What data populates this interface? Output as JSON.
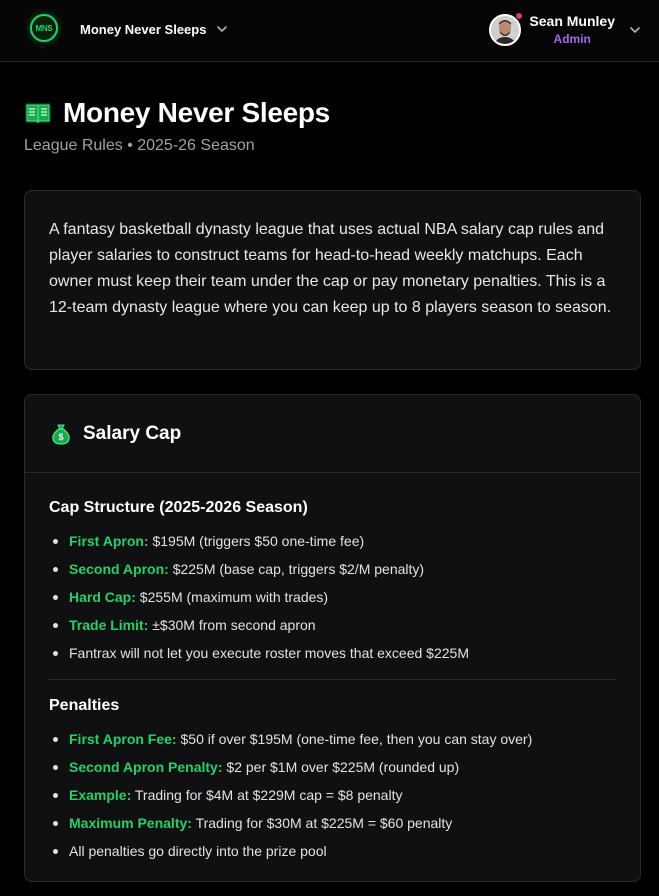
{
  "header": {
    "logo_text": "MNS",
    "league_name": "Money Never Sleeps",
    "user": {
      "name": "Sean Munley",
      "role": "Admin"
    }
  },
  "page": {
    "title": "Money Never Sleeps",
    "subtitle": "League Rules • 2025-26 Season"
  },
  "intro": {
    "text": "A fantasy basketball dynasty league that uses actual NBA salary cap rules and player salaries to construct teams for head-to-head weekly matchups. Each owner must keep their team under the cap or pay monetary penalties. This is a 12-team dynasty league where you can keep up to 8 players season to season."
  },
  "salary_cap": {
    "title": "Salary Cap",
    "cap_structure": {
      "heading": "Cap Structure (2025-2026 Season)",
      "items": [
        {
          "label": "First Apron:",
          "text": " $195M (triggers $50 one-time fee)"
        },
        {
          "label": "Second Apron:",
          "text": " $225M (base cap, triggers $2/M penalty)"
        },
        {
          "label": "Hard Cap:",
          "text": " $255M (maximum with trades)"
        },
        {
          "label": "Trade Limit:",
          "text": " ±$30M from second apron"
        },
        {
          "label": "",
          "text": "Fantrax will not let you execute roster moves that exceed $225M"
        }
      ]
    },
    "penalties": {
      "heading": "Penalties",
      "items": [
        {
          "label": "First Apron Fee:",
          "text": " $50 if over $195M (one-time fee, then you can stay over)"
        },
        {
          "label": "Second Apron Penalty:",
          "text": " $2 per $1M over $225M (rounded up)"
        },
        {
          "label": "Example:",
          "text": " Trading for $4M at $229M cap = $8 penalty"
        },
        {
          "label": "Maximum Penalty:",
          "text": " Trading for $30M at $225M = $60 penalty"
        },
        {
          "label": "",
          "text": "All penalties go directly into the prize pool"
        }
      ]
    }
  },
  "icons": {
    "logo": "basketball-logo-icon",
    "league_dropdown": "chevron-down-icon",
    "user_dropdown": "chevron-down-icon",
    "title": "book-icon",
    "salary_cap": "money-bag-icon",
    "notification": "notification-dot-icon"
  },
  "colors": {
    "accent_green": "#22d263",
    "admin_purple": "#a06bf2",
    "notification_pink": "#e2337d",
    "background": "#000000",
    "card": "#101012"
  }
}
